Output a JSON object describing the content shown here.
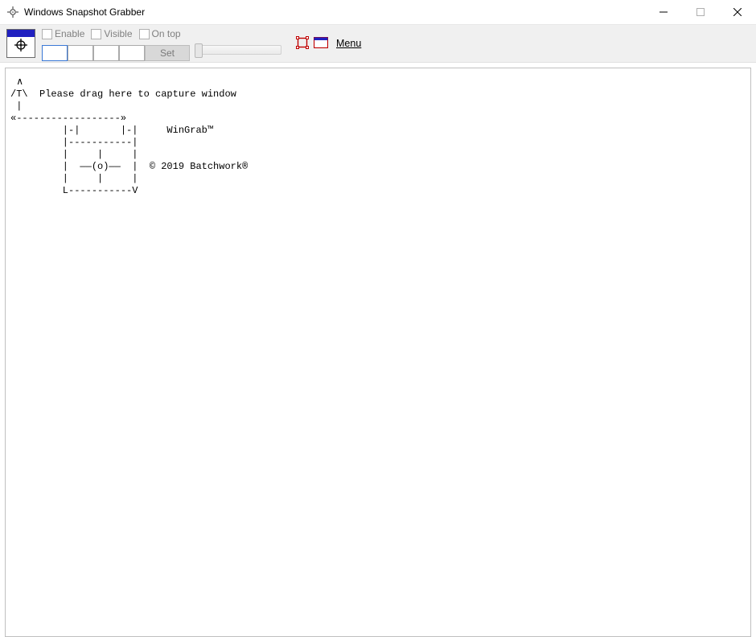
{
  "window": {
    "title": "Windows Snapshot Grabber"
  },
  "toolbar": {
    "enable_label": "Enable",
    "visible_label": "Visible",
    "ontop_label": "On top",
    "set_label": "Set",
    "menu_label": "Menu"
  },
  "ascii_art": " ∧\n/T\\  Please drag here to capture window\n |\n«------------------»\n         |-|       |-|     WinGrab™\n         |-----------|\n         |     |     |\n         |  ——(o)——  |  © 2019 Batchwork®\n         |     |     |\n         L-----------V"
}
